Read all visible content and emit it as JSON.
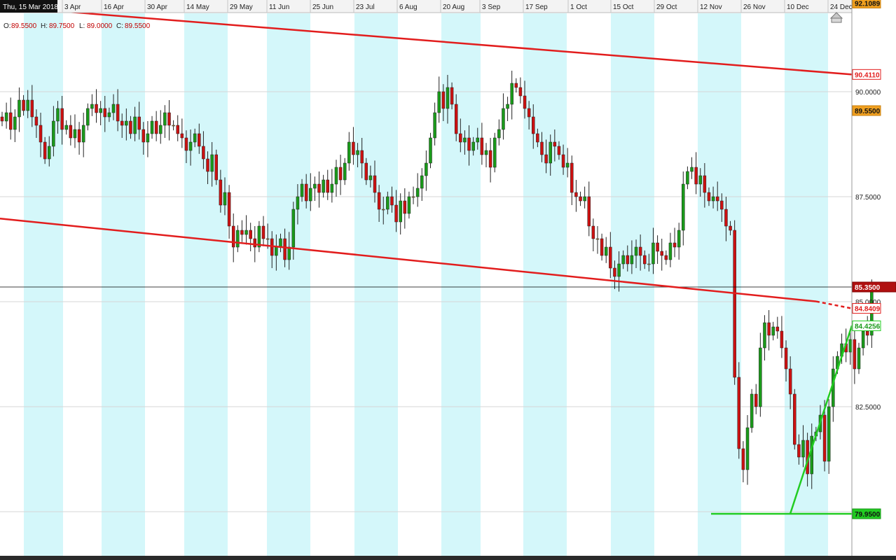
{
  "header": {
    "date_label": "Thu, 15 Mar 2018",
    "ohlc": [
      {
        "key": "O:",
        "value": "89.5500"
      },
      {
        "key": "H:",
        "value": "89.7500"
      },
      {
        "key": "L:",
        "value": "89.0000"
      },
      {
        "key": "C:",
        "value": "89.5500"
      }
    ]
  },
  "colors": {
    "up": "#1a9a1a",
    "down": "#cc1111",
    "doji": "#d79a2a",
    "shade": "#d4f7fa",
    "grid": "#d6d6d6",
    "channel": "#e21d1d",
    "support": "#22cc22",
    "current_line": "#000000"
  },
  "chart_data": {
    "type": "candlestick",
    "timeframe": "daily",
    "x_axis_labels": [
      "3 Apr",
      "16 Apr",
      "30 Apr",
      "14 May",
      "29 May",
      "11 Jun",
      "25 Jun",
      "23 Jul",
      "6 Aug",
      "20 Aug",
      "3 Sep",
      "17 Sep",
      "1 Oct",
      "15 Oct",
      "29 Oct",
      "12 Nov",
      "26 Nov",
      "10 Dec",
      "24 Dec"
    ],
    "y_axis_ticks": [
      "80.0000",
      "82.5000",
      "85.0000",
      "87.5000",
      "90.0000"
    ],
    "y_range": [
      79.5,
      92.5
    ],
    "price_tags": [
      {
        "label": "92.1089",
        "value": 92.1089,
        "style": "orange"
      },
      {
        "label": "90.4110",
        "value": 90.411,
        "style": "red-outline"
      },
      {
        "label": "89.5500",
        "value": 89.55,
        "style": "orange"
      },
      {
        "label": "85.3500",
        "value": 85.35,
        "style": "dark-red"
      },
      {
        "label": "84.8409",
        "value": 84.8409,
        "style": "red-outline"
      },
      {
        "label": "84.4256",
        "value": 84.4256,
        "style": "green-outline"
      },
      {
        "label": "79.9500",
        "value": 79.95,
        "style": "green"
      }
    ],
    "current_price": 85.35,
    "channel_upper": {
      "start": 92.03,
      "end": 90.41
    },
    "channel_lower": {
      "start": 86.98,
      "end": 84.92,
      "projected_end": 84.84
    },
    "support_horizontal": 79.95,
    "support_trend": {
      "from_value": 79.95,
      "to_value": 84.43
    },
    "shaded_bands": [
      [
        34,
        90
      ],
      [
        145,
        207
      ],
      [
        263,
        325
      ],
      [
        381,
        443
      ],
      [
        506,
        568
      ],
      [
        630,
        686
      ],
      [
        747,
        809
      ],
      [
        872,
        934
      ],
      [
        996,
        1058
      ],
      [
        1120,
        1182
      ]
    ],
    "closes": [
      89.3,
      89.5,
      89.1,
      89.4,
      89.8,
      89.55,
      89.8,
      89.4,
      89.2,
      88.8,
      88.4,
      88.7,
      89.3,
      89.6,
      89.1,
      89.2,
      88.9,
      89.1,
      88.8,
      89.2,
      89.6,
      89.7,
      89.5,
      89.6,
      89.4,
      89.5,
      89.7,
      89.3,
      89.2,
      89.3,
      89.0,
      89.4,
      89.1,
      88.8,
      89.0,
      89.3,
      89.0,
      89.2,
      89.5,
      89.2,
      89.2,
      89.0,
      88.9,
      88.6,
      88.8,
      89.0,
      88.7,
      88.4,
      88.1,
      88.5,
      87.9,
      87.3,
      87.6,
      86.8,
      86.3,
      86.7,
      86.6,
      86.7,
      86.5,
      86.3,
      86.8,
      86.5,
      86.5,
      86.1,
      86.3,
      86.5,
      86.0,
      86.3,
      87.2,
      87.5,
      87.8,
      87.4,
      87.7,
      87.8,
      87.6,
      87.9,
      87.6,
      87.8,
      88.2,
      87.9,
      88.3,
      88.8,
      88.5,
      88.6,
      88.3,
      87.9,
      88.0,
      87.6,
      87.2,
      87.2,
      87.5,
      87.3,
      86.9,
      87.4,
      87.1,
      87.5,
      87.5,
      87.7,
      88.0,
      88.3,
      88.9,
      89.5,
      90.0,
      89.6,
      90.1,
      89.7,
      89.0,
      88.8,
      88.9,
      88.6,
      88.8,
      88.9,
      88.5,
      88.6,
      88.2,
      88.9,
      89.1,
      89.6,
      89.7,
      90.2,
      90.1,
      89.9,
      89.6,
      89.4,
      89.0,
      88.8,
      88.5,
      88.3,
      88.8,
      88.7,
      88.5,
      88.2,
      88.3,
      87.6,
      87.5,
      87.4,
      87.5,
      86.8,
      86.5,
      86.5,
      86.1,
      86.3,
      85.8,
      85.6,
      85.9,
      86.1,
      85.9,
      86.1,
      86.3,
      86.1,
      85.9,
      85.9,
      86.4,
      86.2,
      86.1,
      86.0,
      86.4,
      86.3,
      86.7,
      87.8,
      88.1,
      88.2,
      87.8,
      88.0,
      87.6,
      87.4,
      87.5,
      87.4,
      87.2,
      86.8,
      86.7,
      83.2,
      81.5,
      81.0,
      82.0,
      82.8,
      82.5,
      83.9,
      84.5,
      84.2,
      84.4,
      84.3,
      83.9,
      83.4,
      82.8,
      81.6,
      81.3,
      81.7,
      80.9,
      81.8,
      81.9,
      82.3,
      81.2,
      82.5,
      83.4,
      83.7,
      84.0,
      83.8,
      84.1,
      83.4,
      83.9,
      84.3,
      84.2,
      85.35
    ]
  }
}
